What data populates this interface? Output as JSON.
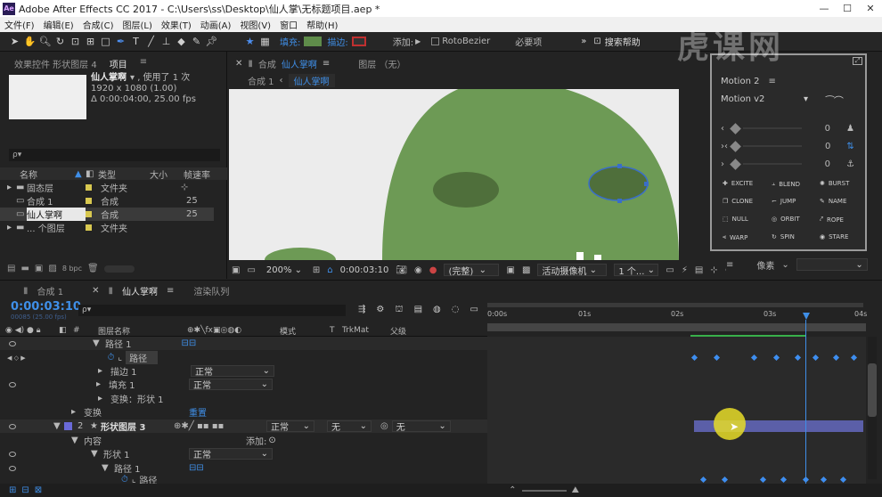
{
  "window": {
    "icon": "Ae",
    "title": "Adobe After Effects CC 2017 - C:\\Users\\ss\\Desktop\\仙人掌\\无标题项目.aep *",
    "min": "—",
    "max": "☐",
    "close": "✕"
  },
  "menu": [
    "文件(F)",
    "编辑(E)",
    "合成(C)",
    "图层(L)",
    "效果(T)",
    "动画(A)",
    "视图(V)",
    "窗口",
    "帮助(H)"
  ],
  "toolbar": {
    "fill_label": "填充:",
    "stroke_label": "描边:",
    "add_label": "添加:",
    "rotobezier": "RotoBezier",
    "essentials": "必要项",
    "search_help": "搜索帮助",
    "fill_color": "#5f8c4a",
    "stroke_color": "#c03030"
  },
  "project": {
    "tab_effects": "效果控件 形状图层 4",
    "tab_project": "项目",
    "item_name": "仙人掌啊",
    "usage": "▾ , 使用了 1 次",
    "dims": "1920 x 1080 (1.00)",
    "duration": "Δ 0:00:04:00, 25.00 fps",
    "search_placeholder": "ρ▾",
    "cols": {
      "name": "名称",
      "type": "类型",
      "size": "大小",
      "fps": "帧速率"
    },
    "items": [
      {
        "name": "固态层",
        "type": "文件夹",
        "fps": "",
        "color": "#d8c850"
      },
      {
        "name": "合成 1",
        "type": "合成",
        "fps": "25",
        "color": "#d8c850"
      },
      {
        "name": "仙人掌啊",
        "type": "合成",
        "fps": "25",
        "color": "#d8c850"
      },
      {
        "name": "... 个图层",
        "type": "文件夹",
        "fps": "",
        "color": "#d8c850"
      }
    ],
    "bpc": "8 bpc"
  },
  "comp": {
    "tab": "合成",
    "tab_name": "仙人掌啊",
    "layer_tab": "图层 （无）",
    "crumb1": "合成 1",
    "crumb2": "仙人掌啊",
    "zoom": "200%",
    "time": "0:00:03:10",
    "quality": "(完整)",
    "camera": "活动摄像机",
    "views": "1 个...",
    "fill": "#6d9a55",
    "eye": "#4f6f3b"
  },
  "motion": {
    "title": "Motion 2",
    "menu_icon": "≡",
    "preset": "Motion v2",
    "sliders": [
      {
        "label": "‹",
        "value": "0"
      },
      {
        "label": "›‹",
        "value": "0"
      },
      {
        "label": "›",
        "value": "0"
      }
    ],
    "buttons": [
      "EXCITE",
      "BLEND",
      "BURST",
      "CLONE",
      "JUMP",
      "NAME",
      "NULL",
      "ORBIT",
      "ROPE",
      "WARP",
      "SPIN",
      "STARE"
    ],
    "pixel_label": "像素"
  },
  "timeline": {
    "tab_comp1": "合成 1",
    "tab_main": "仙人掌啊",
    "tab_render": "渲染队列",
    "time": "0:00:03:10",
    "subtime": "00085 (25.00 fps)",
    "search_placeholder": "ρ▾",
    "col_name": "图层名称",
    "col_mode": "模式",
    "col_t": "T",
    "col_trk": "TrkMat",
    "col_parent": "父级",
    "ruler": [
      "0:00s",
      "01s",
      "02s",
      "03s",
      "04s"
    ],
    "rows": [
      {
        "indent": 1,
        "label": "路径 1"
      },
      {
        "indent": 2,
        "label": "路径"
      },
      {
        "indent": 1,
        "label": "描边 1",
        "mode": "正常"
      },
      {
        "indent": 1,
        "label": "填充 1",
        "mode": "正常"
      },
      {
        "indent": 1,
        "label": "变换：形状 1"
      },
      {
        "indent": 0,
        "label": "变换",
        "right": "重置"
      },
      {
        "indent": 0,
        "label": "形状图层 3",
        "num": "2",
        "mode": "正常",
        "trk": "无",
        "parent": "无"
      },
      {
        "indent": 0,
        "label": "内容",
        "right": "添加:"
      },
      {
        "indent": 1,
        "label": "形状 1",
        "mode": "正常"
      },
      {
        "indent": 2,
        "label": "路径 1"
      },
      {
        "indent": 3,
        "label": "路径"
      }
    ]
  },
  "watermark": "虎课网"
}
